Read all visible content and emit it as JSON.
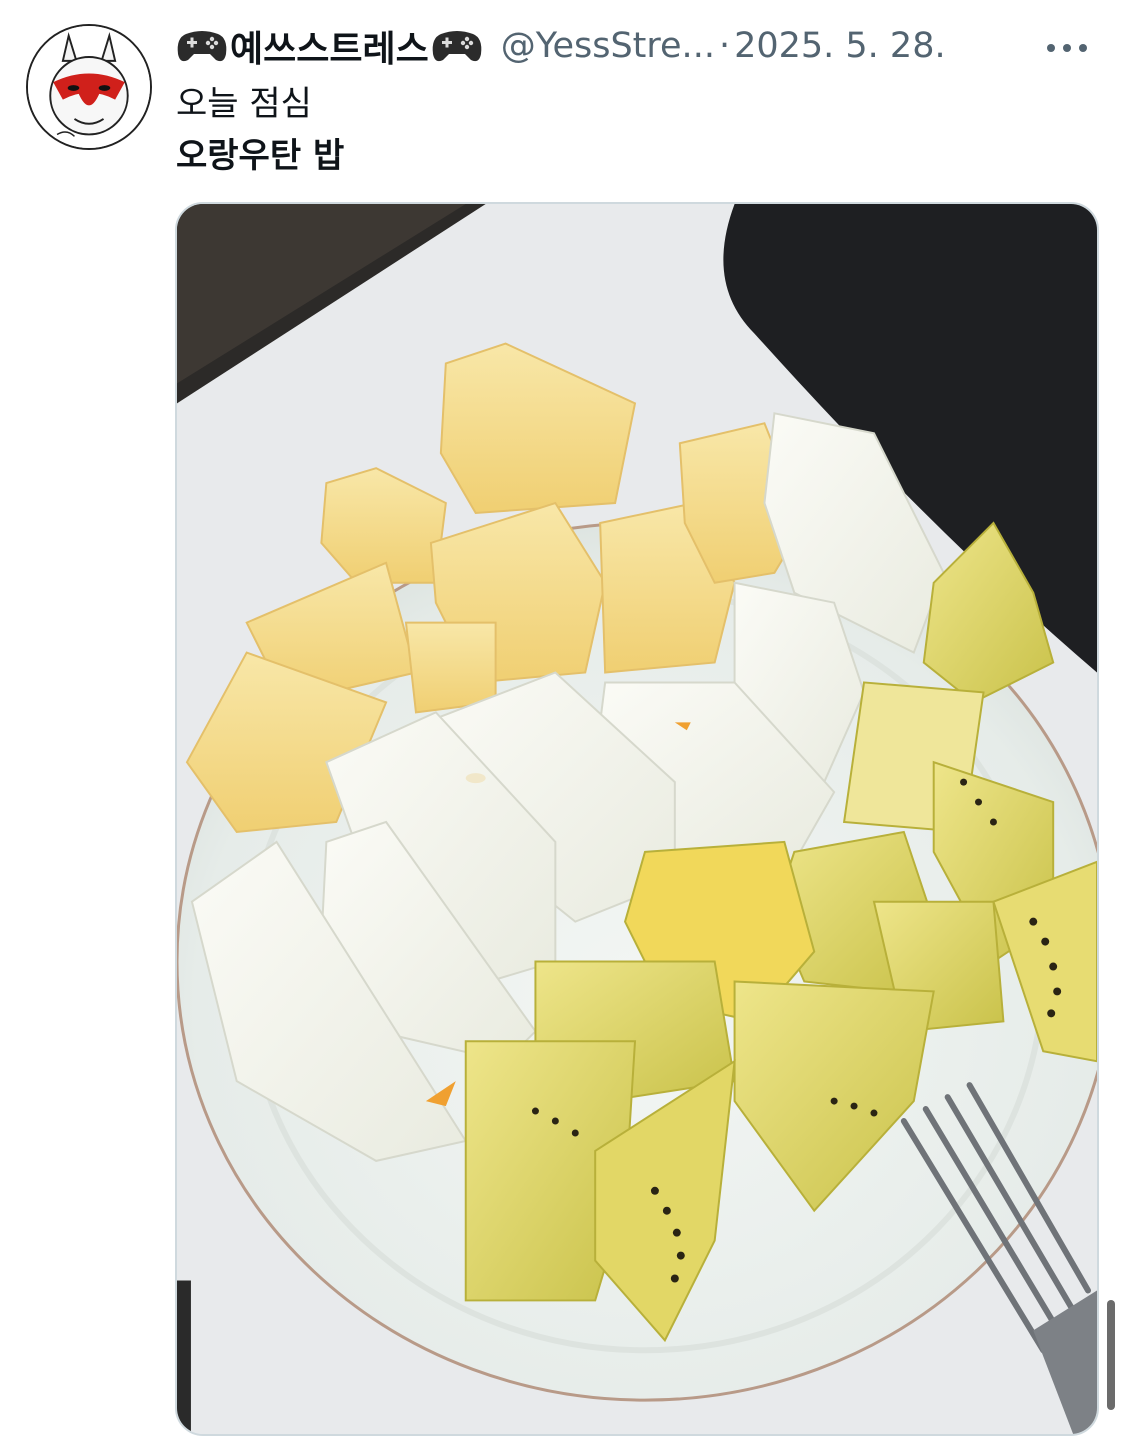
{
  "tweet": {
    "display_name": "예쓰스트레스",
    "display_name_emoji_left": "gamepad-icon",
    "display_name_emoji_right": "gamepad-icon",
    "handle": "@YessStre...",
    "separator": "·",
    "date": "2025. 5. 28.",
    "more_icon": "more-horizontal-icon",
    "text_line1": "오늘 점심",
    "text_line2": "오랑우탄 밥"
  },
  "media": {
    "alt": "Plate of cut fruit: melon, white pear-like melon and golden kiwi, with a fork"
  },
  "colors": {
    "text_primary": "#0f1419",
    "text_secondary": "#536471",
    "media_border": "#cfd9de",
    "avatar_red": "#d0201b"
  }
}
